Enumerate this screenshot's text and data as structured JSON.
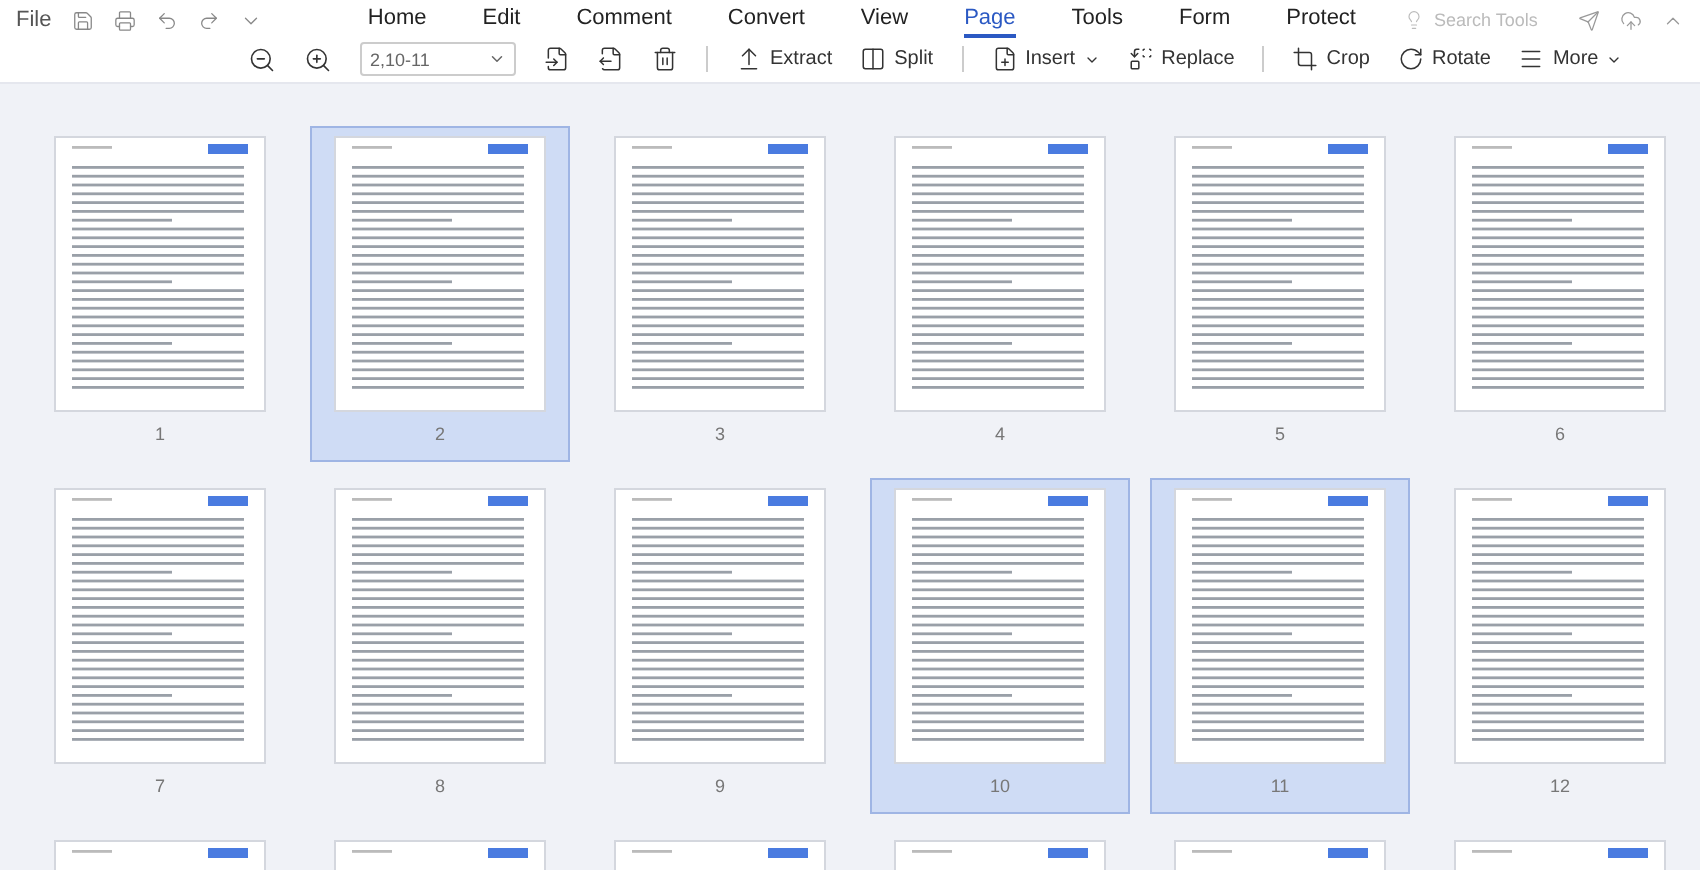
{
  "menu": {
    "file": "File",
    "tabs": [
      {
        "label": "Home",
        "selected": false
      },
      {
        "label": "Edit",
        "selected": false
      },
      {
        "label": "Comment",
        "selected": false
      },
      {
        "label": "Convert",
        "selected": false
      },
      {
        "label": "View",
        "selected": false
      },
      {
        "label": "Page",
        "selected": true
      },
      {
        "label": "Tools",
        "selected": false
      },
      {
        "label": "Form",
        "selected": false
      },
      {
        "label": "Protect",
        "selected": false
      }
    ],
    "search": {
      "placeholder": "Search Tools"
    }
  },
  "toolbar": {
    "page_range": "2,10-11",
    "tools": [
      {
        "kind": "extract",
        "label": "Extract"
      },
      {
        "kind": "split",
        "label": "Split"
      },
      {
        "kind": "insert",
        "label": "Insert",
        "dropdown": true
      },
      {
        "kind": "replace",
        "label": "Replace"
      },
      {
        "kind": "crop",
        "label": "Crop"
      },
      {
        "kind": "rotate",
        "label": "Rotate"
      },
      {
        "kind": "more",
        "label": "More",
        "dropdown": true
      }
    ]
  },
  "pages": [
    {
      "number": "1",
      "selected": false
    },
    {
      "number": "2",
      "selected": true
    },
    {
      "number": "3",
      "selected": false
    },
    {
      "number": "4",
      "selected": false
    },
    {
      "number": "5",
      "selected": false
    },
    {
      "number": "6",
      "selected": false
    },
    {
      "number": "7",
      "selected": false
    },
    {
      "number": "8",
      "selected": false
    },
    {
      "number": "9",
      "selected": false
    },
    {
      "number": "10",
      "selected": true
    },
    {
      "number": "11",
      "selected": true
    },
    {
      "number": "12",
      "selected": false
    }
  ],
  "cut_off_pages": [
    {
      "selected": false
    },
    {
      "selected": false
    },
    {
      "selected": false
    },
    {
      "selected": false
    },
    {
      "selected": false
    },
    {
      "selected": false
    }
  ]
}
